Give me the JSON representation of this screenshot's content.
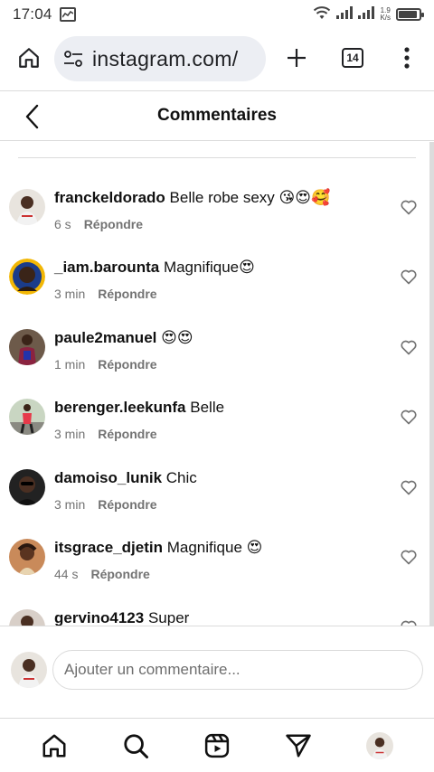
{
  "status_bar": {
    "time": "17:04",
    "network_speed_value": "1.9",
    "network_speed_unit": "K/s",
    "battery_level": 0.9
  },
  "browser": {
    "url": "instagram.com/",
    "tab_count": "14"
  },
  "page": {
    "title": "Commentaires"
  },
  "comments": [
    {
      "username": "franckeldorado",
      "text": "Belle robe sexy 😘😍🥰",
      "time": "6 s",
      "reply_label": "Répondre"
    },
    {
      "username": "_iam.barounta",
      "text": "Magnifique😍",
      "time": "3 min",
      "reply_label": "Répondre"
    },
    {
      "username": "paule2manuel",
      "text": "😍😍",
      "time": "1 min",
      "reply_label": "Répondre"
    },
    {
      "username": "berenger.leekunfa",
      "text": "Belle",
      "time": "3 min",
      "reply_label": "Répondre"
    },
    {
      "username": "damoiso_lunik",
      "text": "Chic",
      "time": "3 min",
      "reply_label": "Répondre"
    },
    {
      "username": "itsgrace_djetin",
      "text": "Magnifique 😍",
      "time": "44 s",
      "reply_label": "Répondre"
    },
    {
      "username": "gervino4123",
      "text": "Super",
      "time": "",
      "reply_label": ""
    }
  ],
  "composer": {
    "placeholder": "Ajouter un commentaire..."
  },
  "colors": {
    "divider": "#dbdbdb",
    "meta_text": "#737373",
    "url_bar_bg": "#eceef3"
  }
}
